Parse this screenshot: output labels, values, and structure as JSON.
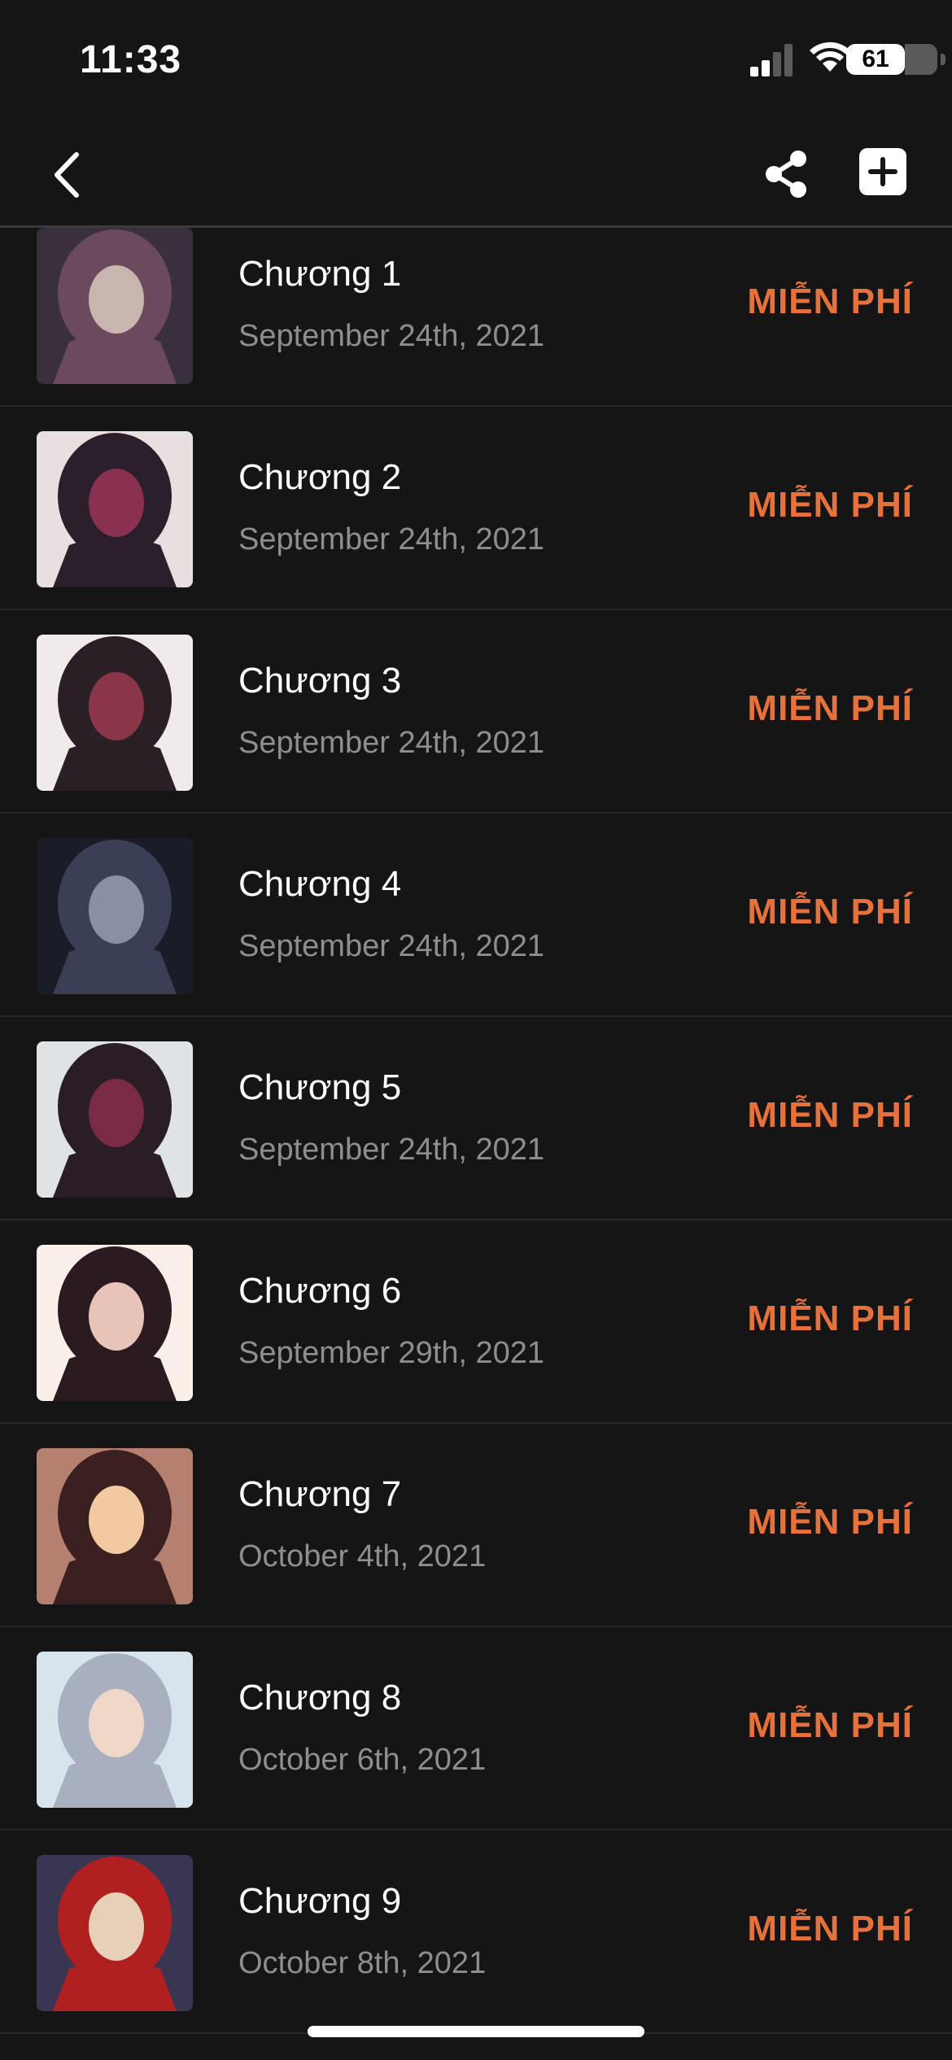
{
  "status": {
    "time": "11:33",
    "battery": "61"
  },
  "colors": {
    "background": "#151515",
    "accent": "#e8713a",
    "date": "#8e8e8e"
  },
  "nav": {
    "back_icon": "chevron-left-icon",
    "share_icon": "share-icon",
    "add_icon": "plus-square-icon"
  },
  "chapters": [
    {
      "title": "Chương 1",
      "date": "September 24th, 2021",
      "price": "MIỄN PHÍ",
      "thumb_colors": [
        "#3a2f3c",
        "#6b4a5e",
        "#c9b5b0"
      ]
    },
    {
      "title": "Chương 2",
      "date": "September 24th, 2021",
      "price": "MIỄN PHÍ",
      "thumb_colors": [
        "#e8e0e0",
        "#2a1f2a",
        "#8a3050"
      ]
    },
    {
      "title": "Chương 3",
      "date": "September 24th, 2021",
      "price": "MIỄN PHÍ",
      "thumb_colors": [
        "#f0eaea",
        "#2a1f25",
        "#8a3548"
      ]
    },
    {
      "title": "Chương 4",
      "date": "September 24th, 2021",
      "price": "MIỄN PHÍ",
      "thumb_colors": [
        "#1a1c28",
        "#3a3f55",
        "#8a8fa5"
      ]
    },
    {
      "title": "Chương 5",
      "date": "September 24th, 2021",
      "price": "MIỄN PHÍ",
      "thumb_colors": [
        "#dfe3e6",
        "#2a1d26",
        "#7a2a45"
      ]
    },
    {
      "title": "Chương 6",
      "date": "September 29th, 2021",
      "price": "MIỄN PHÍ",
      "thumb_colors": [
        "#f8efe8",
        "#2b1a1f",
        "#e8c3b8"
      ]
    },
    {
      "title": "Chương 7",
      "date": "October 4th, 2021",
      "price": "MIỄN PHÍ",
      "thumb_colors": [
        "#b68070",
        "#3a2020",
        "#f2c9a0"
      ]
    },
    {
      "title": "Chương 8",
      "date": "October 6th, 2021",
      "price": "MIỄN PHÍ",
      "thumb_colors": [
        "#d8e4ec",
        "#a8b0c0",
        "#f0d8c8"
      ]
    },
    {
      "title": "Chương 9",
      "date": "October 8th, 2021",
      "price": "MIỄN PHÍ",
      "thumb_colors": [
        "#3a3550",
        "#b02020",
        "#e8d0b8"
      ]
    }
  ]
}
